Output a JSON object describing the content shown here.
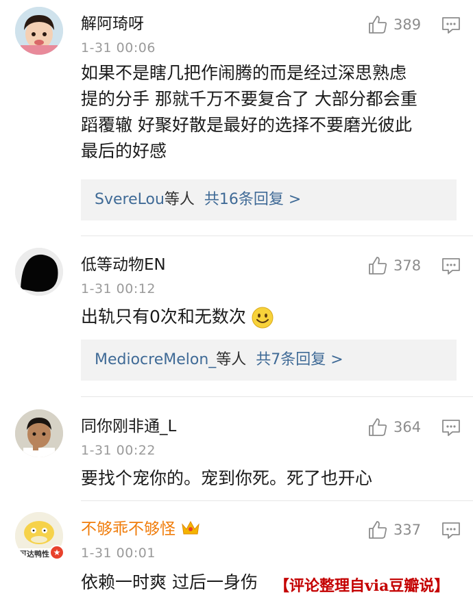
{
  "comments": [
    {
      "username": "解阿琦呀",
      "time": "1-31 00:06",
      "likes": "389",
      "text_lines": [
        "如果不是瞎几把作闹腾的而是经过深思熟虑",
        "提的分手  那就千万不要复合了 大部分都会重",
        "蹈覆辙 好聚好散是最好的选择不要磨光彼此",
        "最后的好感"
      ],
      "reply_users": "SvereLou",
      "reply_suffix": "等人",
      "reply_count": "共16条回复 >"
    },
    {
      "username": "低等动物EN",
      "time": "1-31 00:12",
      "likes": "378",
      "text": "出轨只有0次和无数次",
      "reply_users": "MediocreMelon_",
      "reply_suffix": "等人",
      "reply_count": "共7条回复 >"
    },
    {
      "username": "同你刚非通_L",
      "time": "1-31 00:22",
      "likes": "364",
      "text": "要找个宠你的。宠到你死。死了也开心"
    },
    {
      "username": "不够乖不够怪",
      "time": "1-31 00:01",
      "likes": "337",
      "text": "依赖一时爽 过后一身伤",
      "avatar_label": "可达鸭性"
    }
  ],
  "watermark": "【评论整理自via豆瓣说】",
  "colors": {
    "accent_orange": "#f07c0a",
    "link_blue": "#3f6a96",
    "watermark_red": "#c40000"
  }
}
